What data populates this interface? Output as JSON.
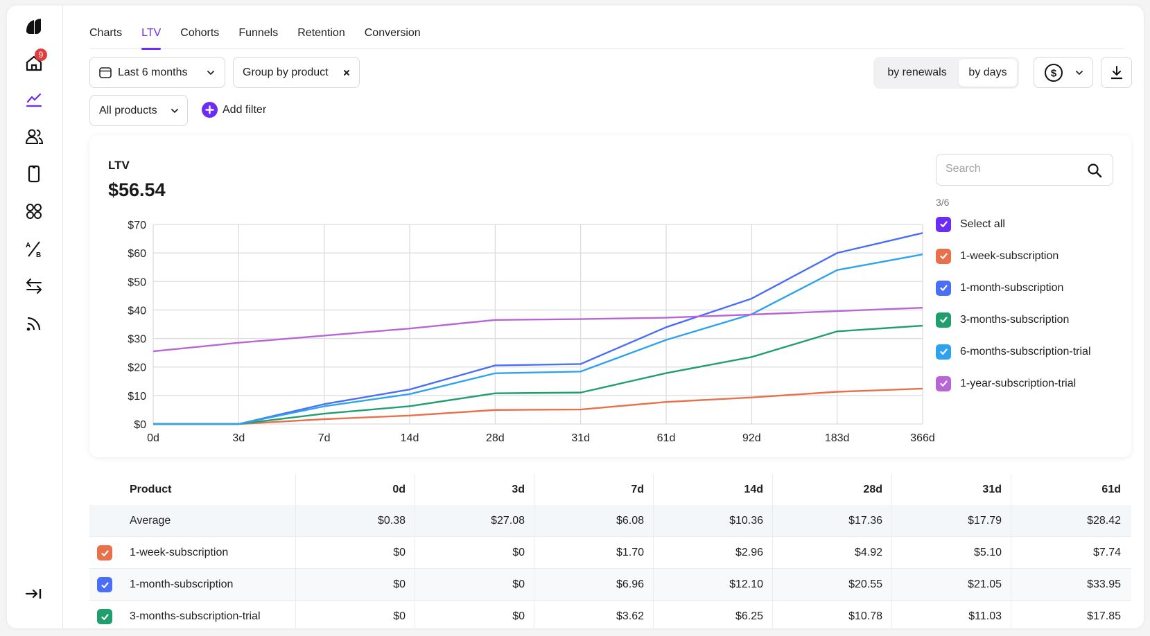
{
  "sidebar": {
    "items": [
      {
        "name": "logo",
        "icon": "leaf-logo-icon"
      },
      {
        "name": "home",
        "icon": "home-icon",
        "badge": "9"
      },
      {
        "name": "analytics",
        "icon": "chart-line-icon",
        "active": true
      },
      {
        "name": "users",
        "icon": "users-icon"
      },
      {
        "name": "devices",
        "icon": "phone-icon"
      },
      {
        "name": "apps",
        "icon": "grid-icon"
      },
      {
        "name": "ab-tests",
        "icon": "ab-test-icon"
      },
      {
        "name": "transfers",
        "icon": "arrows-swap-icon"
      },
      {
        "name": "feed",
        "icon": "rss-icon"
      }
    ],
    "collapse_icon": "collapse-arrow-icon"
  },
  "tabs": [
    {
      "label": "Charts",
      "active": false
    },
    {
      "label": "LTV",
      "active": true
    },
    {
      "label": "Cohorts",
      "active": false
    },
    {
      "label": "Funnels",
      "active": false
    },
    {
      "label": "Retention",
      "active": false
    },
    {
      "label": "Conversion",
      "active": false
    }
  ],
  "filters": {
    "date_range": "Last 6 months",
    "group_by": "Group by product",
    "products": "All products",
    "add_filter": "Add filter"
  },
  "toolbar": {
    "segment": [
      {
        "label": "by renewals",
        "active": false
      },
      {
        "label": "by days",
        "active": true
      }
    ],
    "currency_icon": "dollar-circle-icon",
    "download_icon": "download-icon"
  },
  "summary": {
    "label": "LTV",
    "value": "$56.54"
  },
  "legend": {
    "search_placeholder": "Search",
    "count": "3/6",
    "select_all": "Select all",
    "select_all_color": "#6b2cf5",
    "items": [
      {
        "label": "1-week-subscription",
        "color": "#e8704a"
      },
      {
        "label": "1-month-subscription",
        "color": "#4a6ef5"
      },
      {
        "label": "3-months-subscription",
        "color": "#1f9e6e"
      },
      {
        "label": "6-months-subscription-trial",
        "color": "#2da3ee"
      },
      {
        "label": "1-year-subscription-trial",
        "color": "#b866d6"
      }
    ]
  },
  "chart_data": {
    "type": "line",
    "title": "LTV",
    "xlabel": "",
    "ylabel": "",
    "x": [
      "0d",
      "3d",
      "7d",
      "14d",
      "28d",
      "31d",
      "61d",
      "92d",
      "183d",
      "366d"
    ],
    "yticks": [
      "$0",
      "$10",
      "$20",
      "$30",
      "$40",
      "$50",
      "$60",
      "$70"
    ],
    "ylim": [
      0,
      70
    ],
    "grid": true,
    "legend_position": "right",
    "series": [
      {
        "name": "1-week-subscription",
        "color": "#e8704a",
        "values": [
          0,
          0,
          1.7,
          2.96,
          4.92,
          5.1,
          7.74,
          9.3,
          11.3,
          12.4
        ]
      },
      {
        "name": "1-month-subscription",
        "color": "#4a6ef5",
        "values": [
          0,
          0,
          6.96,
          12.1,
          20.55,
          21.05,
          33.95,
          44,
          60,
          67
        ]
      },
      {
        "name": "3-months-subscription",
        "color": "#1f9e6e",
        "values": [
          0,
          0,
          3.62,
          6.25,
          10.78,
          11.03,
          17.85,
          23.5,
          32.5,
          34.5
        ]
      },
      {
        "name": "6-months-subscription-trial",
        "color": "#2da3ee",
        "values": [
          0,
          0,
          6.2,
          10.5,
          17.8,
          18.4,
          29.5,
          38.5,
          54,
          59.5
        ]
      },
      {
        "name": "1-year-subscription-trial",
        "color": "#b866d6",
        "values": [
          25.5,
          28.5,
          31,
          33.5,
          36.5,
          36.8,
          37.3,
          38.4,
          39.6,
          40.8
        ]
      }
    ]
  },
  "table": {
    "columns": [
      "Product",
      "0d",
      "3d",
      "7d",
      "14d",
      "28d",
      "31d",
      "61d"
    ],
    "average": {
      "label": "Average",
      "values": [
        "$0.38",
        "$27.08",
        "$6.08",
        "$10.36",
        "$17.36",
        "$17.79",
        "$28.42"
      ]
    },
    "rows": [
      {
        "label": "1-week-subscription",
        "color": "#e8704a",
        "values": [
          "$0",
          "$0",
          "$1.70",
          "$2.96",
          "$4.92",
          "$5.10",
          "$7.74"
        ]
      },
      {
        "label": "1-month-subscription",
        "color": "#4a6ef5",
        "values": [
          "$0",
          "$0",
          "$6.96",
          "$12.10",
          "$20.55",
          "$21.05",
          "$33.95"
        ]
      },
      {
        "label": "3-months-subscription-trial",
        "color": "#1f9e6e",
        "values": [
          "$0",
          "$0",
          "$3.62",
          "$6.25",
          "$10.78",
          "$11.03",
          "$17.85"
        ]
      }
    ]
  }
}
